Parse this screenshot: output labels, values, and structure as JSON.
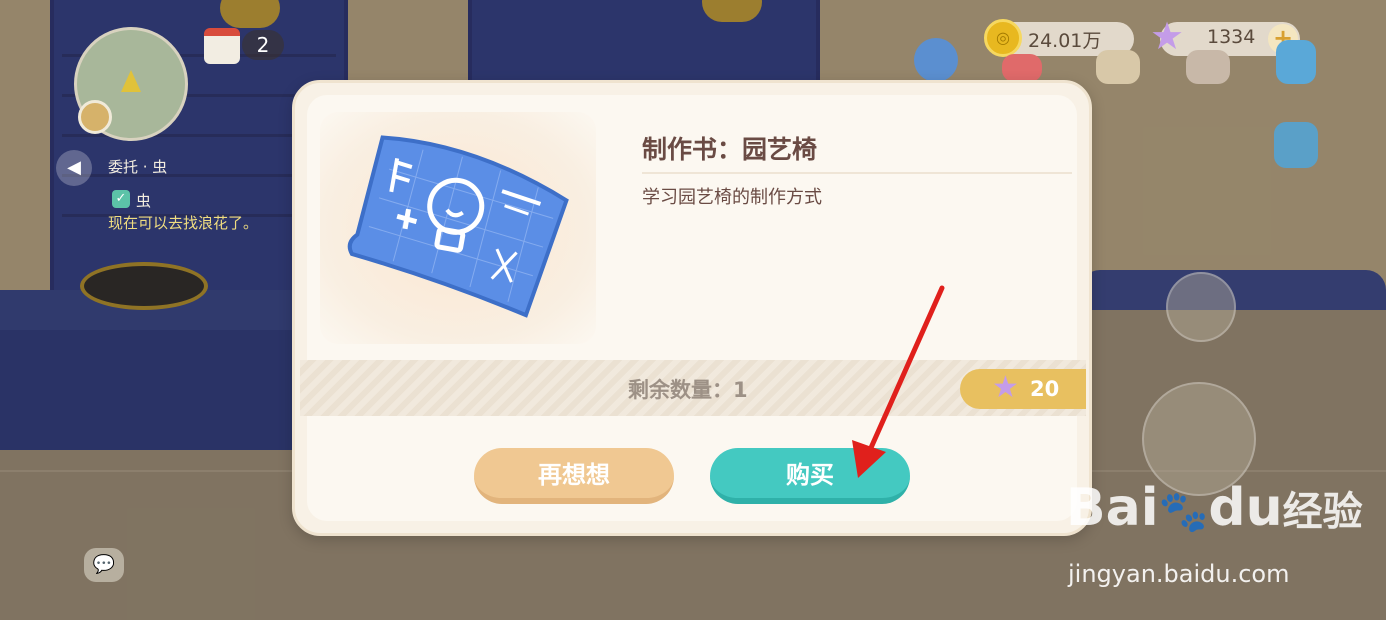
{
  "hud": {
    "calendar_count": "2",
    "quest_title": "委托 · 虫",
    "quest_subtask": "虫",
    "quest_description": "现在可以去找浪花了。",
    "coins": "24.01万",
    "stars": "1334",
    "plus_label": "+"
  },
  "dialog": {
    "item_title": "制作书：园艺椅",
    "item_description": "学习园艺椅的制作方式",
    "remaining_label": "剩余数量：1",
    "price": "20",
    "cancel_label": "再想想",
    "buy_label": "购买"
  },
  "watermark": {
    "brand_a": "Bai",
    "brand_b": "du",
    "brand_c": "经验",
    "url": "jingyan.baidu.com"
  },
  "colors": {
    "buy_button": "#44c9c1",
    "cancel_button": "#f0c892",
    "price_pill": "#e8c060",
    "annotation_arrow": "#e0201c"
  }
}
